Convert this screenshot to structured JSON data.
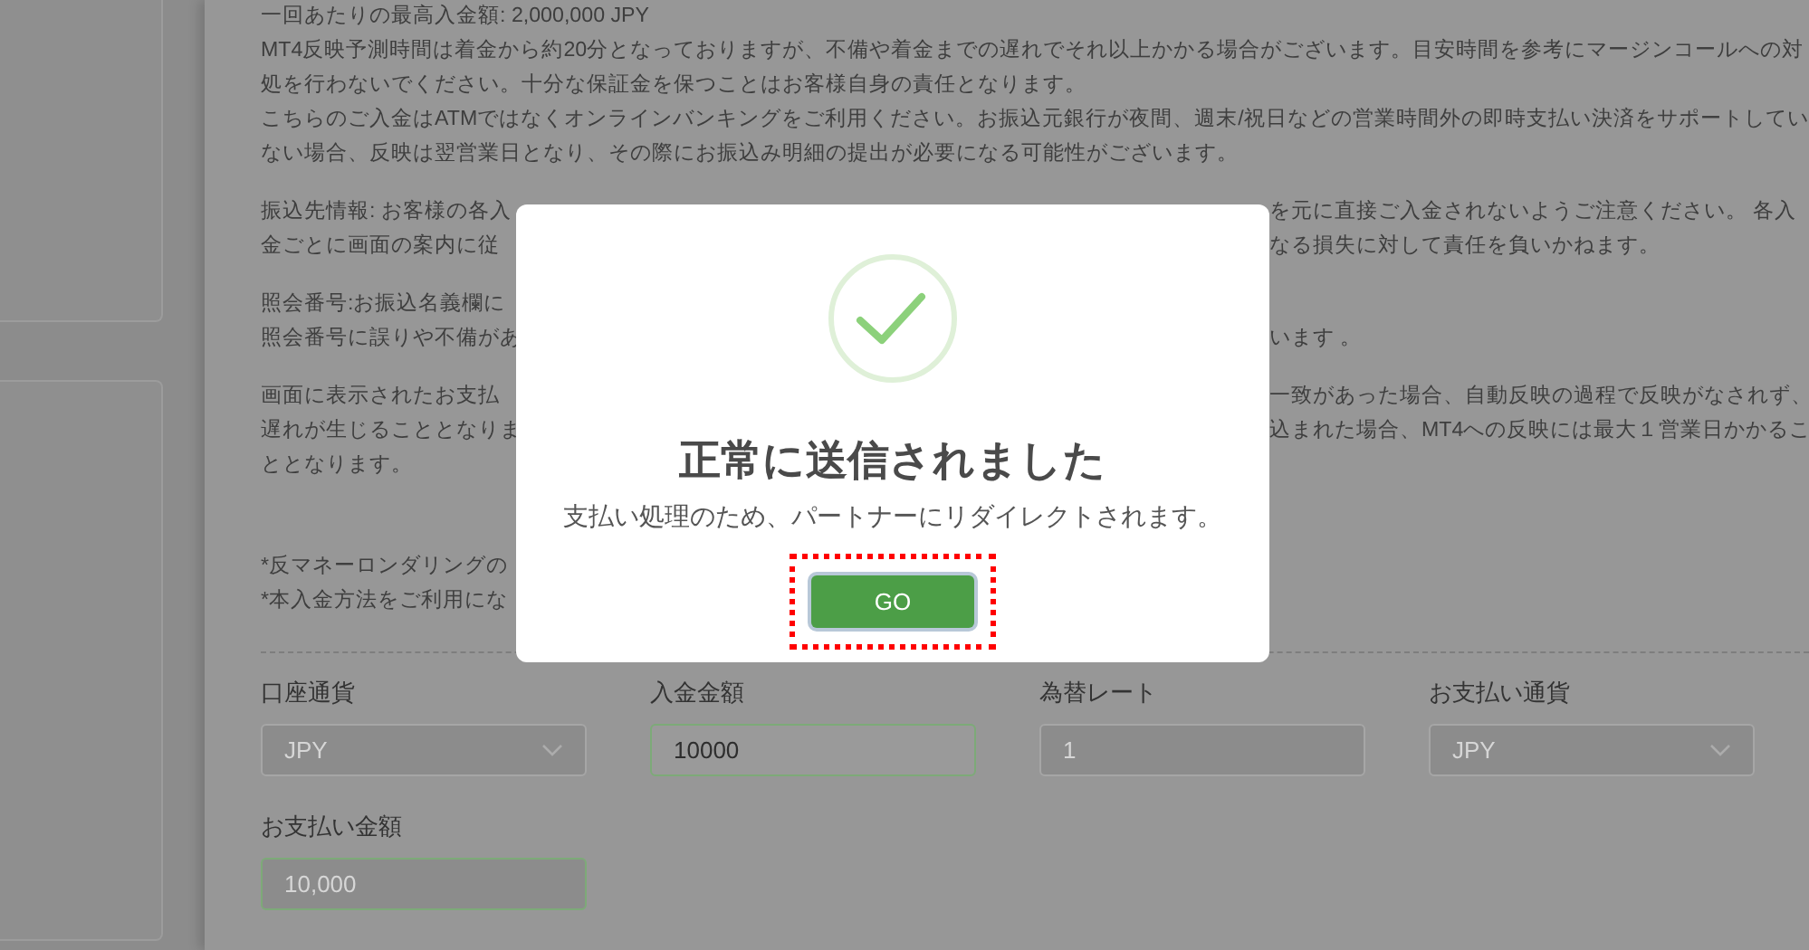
{
  "notice_paragraphs": [
    [
      {
        "left": "一回あたりの最高入金額:  2,000,000 JPY"
      },
      {
        "left": "MT4反映予測時間は着金から約20分となっておりますが、不備や着金までの遅れでそれ以上かかる場合がございます。目安時間を参考にマージンコールへの対"
      },
      {
        "left": "処を行わないでください。十分な保証金を保つことはお客様自身の責任となります。"
      },
      {
        "left": "こちらのご入金はATMではなくオンラインバンキングをご利用ください。お振込元銀行が夜間、週末/祝日などの営業時間外の即時支払い決済をサポートしてい"
      },
      {
        "left": "ない場合、反映は翌営業日となり、その際にお振込み明細の提出が必要になる可能性がございます。"
      }
    ],
    [
      {
        "left": "振込先情報: お客様の各入",
        "right": "を元に直接ご入金されないようご注意ください。 各入"
      },
      {
        "left": "金ごとに画面の案内に従",
        "right": "なる損失に対して責任を負いかねます。"
      }
    ],
    [
      {
        "left": "照会番号:お振込名義欄に"
      },
      {
        "left": "照会番号に誤りや不備があ",
        "right": "います 。"
      }
    ],
    [
      {
        "left": "画面に表示されたお支払",
        "right": "一致があった場合、自動反映の過程で反映がなされず、"
      },
      {
        "left": "遅れが生じることとなりま",
        "right": "込まれた場合、MT4への反映には最大１営業日かかるこ"
      },
      {
        "left": "ととなります。"
      }
    ],
    [
      {
        "left": "*反マネーロンダリングの"
      },
      {
        "left": "*本入金方法をご利用にな"
      }
    ]
  ],
  "form_fields": [
    {
      "label": "口座通貨",
      "kind": "select",
      "value": "JPY",
      "disabled": true,
      "highlighted": false
    },
    {
      "label": "入金金額",
      "kind": "text",
      "value": "10000",
      "disabled": false,
      "highlighted": true
    },
    {
      "label": "為替レート",
      "kind": "text",
      "value": "1",
      "disabled": true,
      "highlighted": false
    },
    {
      "label": "お支払い通貨",
      "kind": "select",
      "value": "JPY",
      "disabled": true,
      "highlighted": false
    },
    {
      "label": "お支払い金額",
      "kind": "text",
      "value": "10,000",
      "disabled": true,
      "highlighted": true
    }
  ],
  "dialog": {
    "title": "正常に送信されました",
    "message": "支払い処理のため、パートナーにリダイレクトされます。",
    "button": "GO",
    "button_highlighted": true
  }
}
